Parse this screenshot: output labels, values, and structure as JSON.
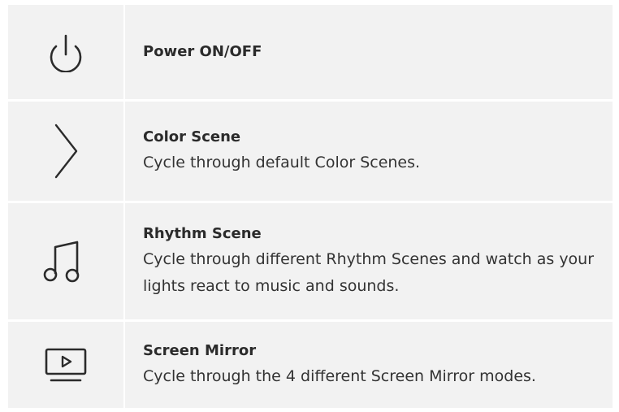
{
  "colors": {
    "row_background": "#f2f2f2",
    "divider": "#ffffff",
    "text": "#2b2b2b",
    "icon_stroke": "#2b2b2b"
  },
  "rows": [
    {
      "icon": "power-icon",
      "title": "Power ON/OFF",
      "description": ""
    },
    {
      "icon": "chevron-right-icon",
      "title": "Color Scene",
      "description": "Cycle through default Color Scenes."
    },
    {
      "icon": "music-note-icon",
      "title": "Rhythm Scene",
      "description": "Cycle through different Rhythm Scenes and watch as your lights react to music and sounds."
    },
    {
      "icon": "screen-play-icon",
      "title": "Screen Mirror",
      "description": "Cycle through the 4 different Screen Mirror modes."
    }
  ]
}
